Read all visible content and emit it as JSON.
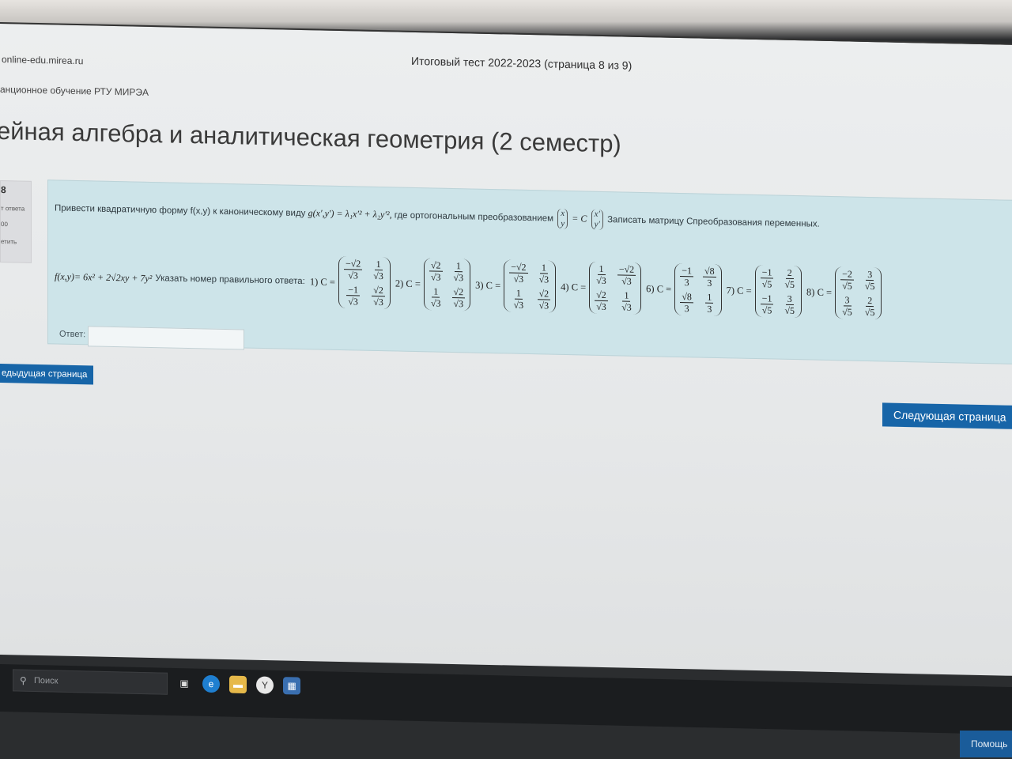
{
  "browser": {
    "url": "online-edu.mirea.ru",
    "title": "Итоговый тест 2022-2023 (страница 8 из 9)"
  },
  "breadcrumb": "анционное обучение РТУ МИРЭА",
  "course_title": "ейная алгебра и аналитическая геометрия (2 семестр)",
  "question_info": {
    "number": "8",
    "status": "т ответа",
    "mark": "00",
    "flag": "етить"
  },
  "question": {
    "intro": "Привести квадратичную форму f(x,y) к каноническому виду",
    "canonical": "g(x′,y′) = λ₁x′² + λ₂y′²,",
    "where": "где  ортогональным преобразованием",
    "vec_left_top": "x",
    "vec_left_bottom": "y",
    "eq_c": "= C",
    "vec_right_top": "x′",
    "vec_right_bottom": "y′",
    "task": "Записать матрицу Спреобразования переменных.",
    "form": "f(x,y)= 6x² + 2√2xy + 7y²",
    "instruction": "Указать номер правильного ответа:",
    "options": [
      {
        "label": "1) C =",
        "m": [
          [
            "−√2",
            "√3"
          ],
          [
            "1",
            "√3"
          ],
          [
            "−1",
            "√3"
          ],
          [
            "√2",
            "√3"
          ]
        ]
      },
      {
        "label": "2) C =",
        "m": [
          [
            "√2",
            "√3"
          ],
          [
            "1",
            "√3"
          ],
          [
            "1",
            "√3"
          ],
          [
            "√2",
            "√3"
          ]
        ]
      },
      {
        "label": "3) C =",
        "m": [
          [
            "−√2",
            "√3"
          ],
          [
            "1",
            "√3"
          ],
          [
            "1",
            "√3"
          ],
          [
            "√2",
            "√3"
          ]
        ]
      },
      {
        "label": "4) C =",
        "m": [
          [
            "1",
            "√3"
          ],
          [
            "−√2",
            "√3"
          ],
          [
            "√2",
            "√3"
          ],
          [
            "1",
            "√3"
          ]
        ]
      },
      {
        "label": "6) C =",
        "m": [
          [
            "−1",
            "3"
          ],
          [
            "√8",
            "3"
          ],
          [
            "√8",
            "3"
          ],
          [
            "1",
            "3"
          ]
        ]
      },
      {
        "label": "7) C =",
        "m": [
          [
            "−1",
            "√5"
          ],
          [
            "2",
            "√5"
          ],
          [
            "−1",
            "√5"
          ],
          [
            "3",
            "√5"
          ]
        ]
      },
      {
        "label": "8) C =",
        "m": [
          [
            "−2",
            "√5"
          ],
          [
            "3",
            "√5"
          ],
          [
            "3",
            "√5"
          ],
          [
            "2",
            "√5"
          ]
        ]
      }
    ],
    "answer_label": "Ответ:",
    "answer_value": ""
  },
  "nav": {
    "prev": "едыдущая страница",
    "next": "Следующая страница"
  },
  "taskbar": {
    "search_placeholder": "Поиск",
    "help": "Помощь"
  },
  "colors": {
    "question_bg": "#cde4e9",
    "button_blue": "#1765a8"
  }
}
